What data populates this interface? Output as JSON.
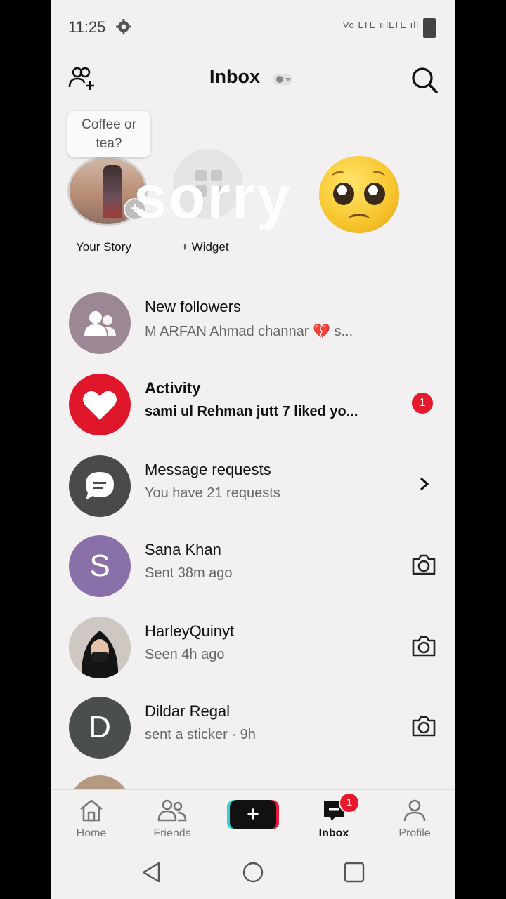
{
  "status_bar": {
    "time": "11:25",
    "signal_text": "Vo LTE ıılLTE ıll"
  },
  "header": {
    "title": "Inbox"
  },
  "stories": {
    "tooltip": "Coffee or tea?",
    "your_story_label": "Your Story",
    "widget_label": "+ Widget",
    "overlay_text": "sorry"
  },
  "list": [
    {
      "name": "New followers",
      "sub": "M ARFAN Ahmad channar 💔 s...",
      "icon": "people-icon",
      "color": "#9c8795"
    },
    {
      "name": "Activity",
      "sub": "sami ul Rehman jutt 7 liked yo...",
      "icon": "heart-icon",
      "color": "#e0172b",
      "badge": "1"
    },
    {
      "name": "Message requests",
      "sub": "You have 21 requests",
      "icon": "chat-icon",
      "color": "#4a4a4a"
    },
    {
      "name": "Sana Khan",
      "sub": "Sent 38m ago",
      "initial": "S",
      "color": "#8a70a8"
    },
    {
      "name": "HarleyQuinyt",
      "sub": "Seen 4h ago"
    },
    {
      "name": "Dildar Regal",
      "sub": "sent a sticker · 9h",
      "initial": "D",
      "color": "#4b4f4b"
    }
  ],
  "bottom_nav": {
    "home": "Home",
    "friends": "Friends",
    "inbox": "Inbox",
    "profile": "Profile",
    "inbox_badge": "1"
  }
}
